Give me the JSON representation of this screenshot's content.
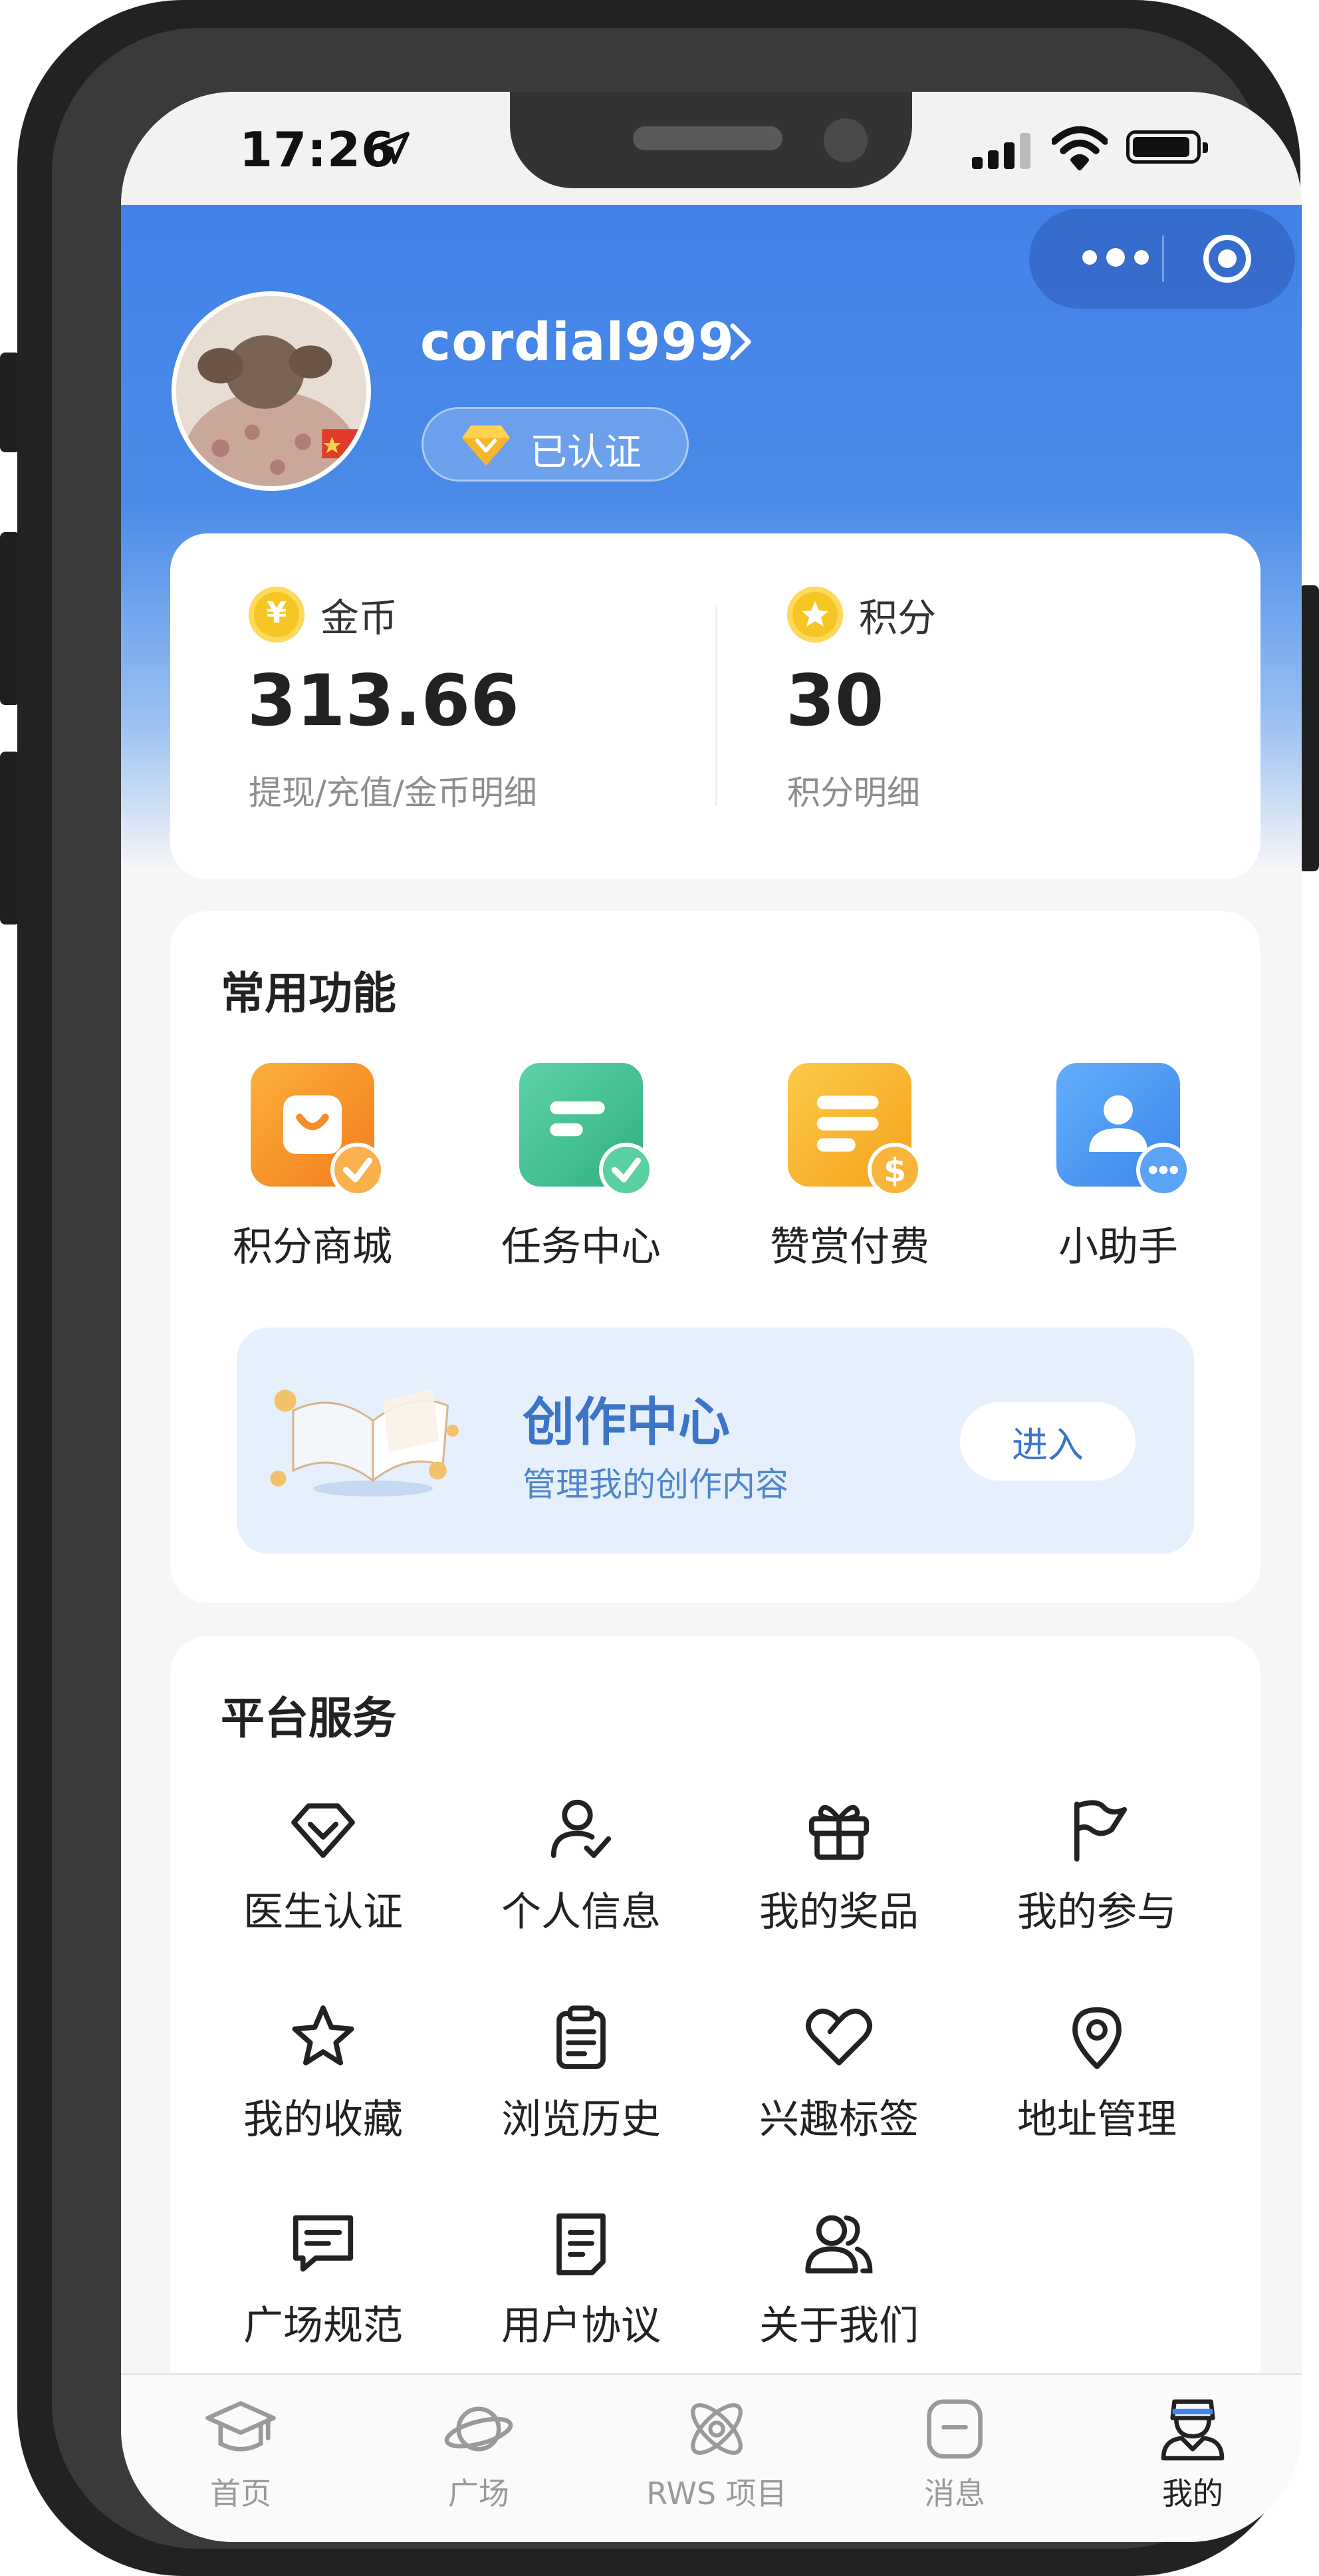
{
  "status_bar": {
    "time": "17:26"
  },
  "profile": {
    "username": "cordial999",
    "verified_label": "已认证"
  },
  "wallet": {
    "coins": {
      "icon": "yen-coin-icon",
      "label": "金币",
      "value": "313.66",
      "sub": "提现/充值/金币明细"
    },
    "points": {
      "icon": "star-coin-icon",
      "label": "积分",
      "value": "30",
      "sub": "积分明细"
    }
  },
  "common_functions": {
    "title": "常用功能",
    "items": [
      {
        "label": "积分商城",
        "icon": "bag-check-icon",
        "color": "#f5922a"
      },
      {
        "label": "任务中心",
        "icon": "task-check-icon",
        "color": "#43c192"
      },
      {
        "label": "赞赏付费",
        "icon": "pay-dollar-icon",
        "color": "#f6b533"
      },
      {
        "label": "小助手",
        "icon": "assistant-icon",
        "color": "#4a9af2"
      }
    ],
    "creation": {
      "title": "创作中心",
      "subtitle": "管理我的创作内容",
      "button": "进入"
    }
  },
  "platform_services": {
    "title": "平台服务",
    "items": [
      {
        "label": "医生认证",
        "icon": "diamond-icon"
      },
      {
        "label": "个人信息",
        "icon": "user-check-icon"
      },
      {
        "label": "我的奖品",
        "icon": "gift-icon"
      },
      {
        "label": "我的参与",
        "icon": "flag-icon"
      },
      {
        "label": "我的收藏",
        "icon": "star-icon"
      },
      {
        "label": "浏览历史",
        "icon": "clipboard-icon"
      },
      {
        "label": "兴趣标签",
        "icon": "heart-icon"
      },
      {
        "label": "地址管理",
        "icon": "location-pin-icon"
      },
      {
        "label": "广场规范",
        "icon": "message-icon"
      },
      {
        "label": "用户协议",
        "icon": "document-icon"
      },
      {
        "label": "关于我们",
        "icon": "users-icon"
      }
    ]
  },
  "tab_bar": {
    "items": [
      {
        "label": "首页",
        "icon": "graduation-cap-icon"
      },
      {
        "label": "广场",
        "icon": "planet-icon"
      },
      {
        "label": "RWS 项目",
        "icon": "atom-icon"
      },
      {
        "label": "消息",
        "icon": "message-box-icon"
      },
      {
        "label": "我的",
        "icon": "nurse-icon",
        "active": true
      }
    ]
  },
  "colors": {
    "header_blue": "#4282e8",
    "accent_blue": "#3c74c8",
    "coin_yellow": "#f6c625"
  }
}
